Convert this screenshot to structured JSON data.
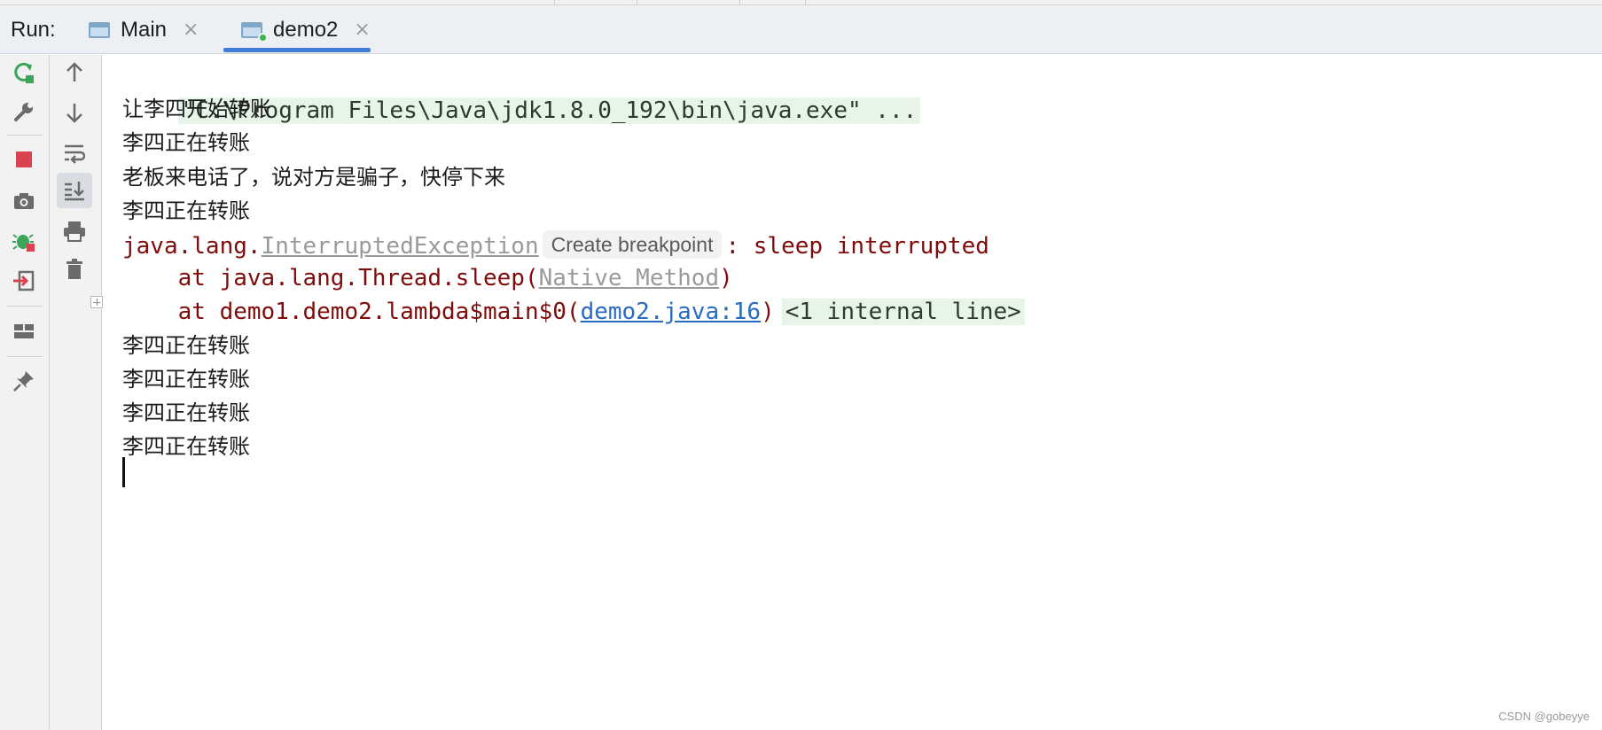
{
  "run_window": {
    "label": "Run:",
    "tabs": [
      {
        "title": "Main",
        "close": "×"
      },
      {
        "title": "demo2",
        "close": "×"
      }
    ]
  },
  "toolbar_left": [
    {
      "icon": "rerun-icon",
      "color": "#3ba55a"
    },
    {
      "icon": "wrench-icon",
      "color": "#6b6b6b"
    },
    {
      "icon": "stop-icon",
      "color": "#d9434f"
    },
    {
      "icon": "camera-icon",
      "color": "#6b6b6b"
    },
    {
      "icon": "debug-icon",
      "color": "#3ba55a"
    },
    {
      "icon": "exit-icon",
      "color": "#d9434f"
    },
    {
      "icon": "layout-icon",
      "color": "#6b6b6b"
    },
    {
      "icon": "pin-icon",
      "color": "#6b6b6b"
    }
  ],
  "toolbar_right": [
    {
      "icon": "arrow-up-icon"
    },
    {
      "icon": "arrow-down-icon"
    },
    {
      "icon": "soft-wrap-icon"
    },
    {
      "icon": "scroll-to-end-icon",
      "active": true
    },
    {
      "icon": "print-icon"
    },
    {
      "icon": "trash-icon"
    }
  ],
  "console": {
    "command": "\"C:\\Program Files\\Java\\jdk1.8.0_192\\bin\\java.exe\" ...",
    "out1": "让李四开始转账",
    "out2": "李四正在转账",
    "out3": "老板来电话了，说对方是骗子，快停下来",
    "out4": "李四正在转账",
    "exception": {
      "prefix": "java.lang.",
      "class_name": "InterruptedException",
      "breakpoint_chip": "Create breakpoint",
      "message": ": sleep interrupted"
    },
    "stack1": {
      "prefix": "    at java.lang.Thread.sleep(",
      "link": "Native Method",
      "suffix": ")"
    },
    "stack2": {
      "prefix": "    at demo1.demo2.lambda$main$0(",
      "link": "demo2.java:16",
      "suffix": ")",
      "internal": "<1 internal line>"
    },
    "out5": "李四正在转账",
    "out6": "李四正在转账",
    "out7": "李四正在转账",
    "out8": "李四正在转账"
  },
  "watermark": "CSDN @gobeyye"
}
